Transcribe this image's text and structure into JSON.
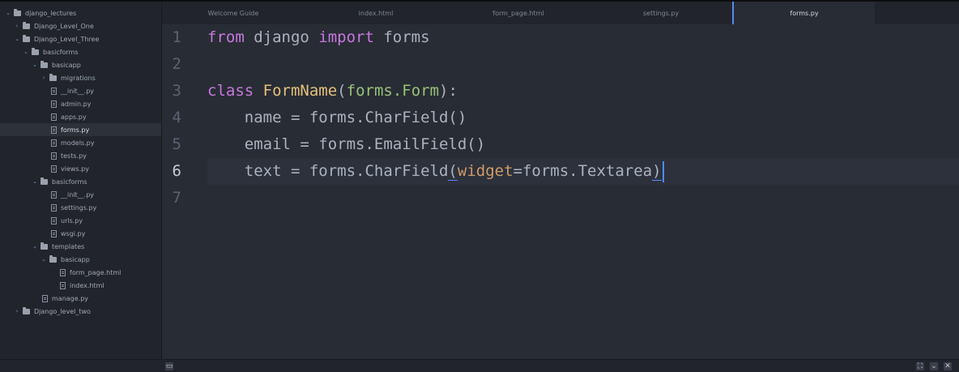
{
  "tree": [
    {
      "label": "django_lectures",
      "kind": "folder",
      "expanded": true,
      "depth": 0
    },
    {
      "label": "Django_Level_One",
      "kind": "folder",
      "expanded": false,
      "depth": 1
    },
    {
      "label": "Django_Level_Three",
      "kind": "folder",
      "expanded": true,
      "depth": 1
    },
    {
      "label": "basicforms",
      "kind": "folder",
      "expanded": true,
      "depth": 2
    },
    {
      "label": "basicapp",
      "kind": "folder",
      "expanded": true,
      "depth": 3
    },
    {
      "label": "migrations",
      "kind": "folder",
      "expanded": false,
      "depth": 4
    },
    {
      "label": "__init__.py",
      "kind": "file",
      "depth": 4
    },
    {
      "label": "admin.py",
      "kind": "file",
      "depth": 4
    },
    {
      "label": "apps.py",
      "kind": "file",
      "depth": 4
    },
    {
      "label": "forms.py",
      "kind": "file",
      "depth": 4,
      "selected": true
    },
    {
      "label": "models.py",
      "kind": "file",
      "depth": 4
    },
    {
      "label": "tests.py",
      "kind": "file",
      "depth": 4
    },
    {
      "label": "views.py",
      "kind": "file",
      "depth": 4
    },
    {
      "label": "basicforms",
      "kind": "folder",
      "expanded": true,
      "depth": 3
    },
    {
      "label": "__init__.py",
      "kind": "file",
      "depth": 4
    },
    {
      "label": "settings.py",
      "kind": "file",
      "depth": 4
    },
    {
      "label": "urls.py",
      "kind": "file",
      "depth": 4
    },
    {
      "label": "wsgi.py",
      "kind": "file",
      "depth": 4
    },
    {
      "label": "templates",
      "kind": "folder",
      "expanded": true,
      "depth": 3
    },
    {
      "label": "basicapp",
      "kind": "folder",
      "expanded": true,
      "depth": 4
    },
    {
      "label": "form_page.html",
      "kind": "file",
      "depth": 5
    },
    {
      "label": "index.html",
      "kind": "file",
      "depth": 5
    },
    {
      "label": "manage.py",
      "kind": "file",
      "depth": 3
    },
    {
      "label": "Django_level_two",
      "kind": "folder",
      "expanded": false,
      "depth": 1
    }
  ],
  "tabs": [
    {
      "label": "Welcome Guide",
      "active": false
    },
    {
      "label": "index.html",
      "active": false
    },
    {
      "label": "form_page.html",
      "active": false
    },
    {
      "label": "settings.py",
      "active": false
    },
    {
      "label": "forms.py",
      "active": true
    }
  ],
  "editor": {
    "current_line": 6,
    "lines": [
      {
        "num": "1",
        "tokens": [
          [
            "kw",
            "from"
          ],
          [
            "t",
            " django "
          ],
          [
            "kw",
            "import"
          ],
          [
            "t",
            " forms"
          ]
        ]
      },
      {
        "num": "2",
        "tokens": []
      },
      {
        "num": "3",
        "tokens": [
          [
            "kw",
            "class"
          ],
          [
            "t",
            " "
          ],
          [
            "cls",
            "FormName"
          ],
          [
            "t",
            "("
          ],
          [
            "inh",
            "forms.Form"
          ],
          [
            "t",
            "):"
          ]
        ]
      },
      {
        "num": "4",
        "tokens": [
          [
            "t",
            "    name = forms.CharField()"
          ]
        ]
      },
      {
        "num": "5",
        "tokens": [
          [
            "t",
            "    email = forms.EmailField()"
          ]
        ]
      },
      {
        "num": "6",
        "tokens": [
          [
            "t",
            "    text = forms.CharField"
          ],
          [
            "brk",
            "("
          ],
          [
            "prm",
            "widget"
          ],
          [
            "t",
            "=forms.Textarea"
          ],
          [
            "brk",
            ")"
          ]
        ]
      },
      {
        "num": "7",
        "tokens": []
      }
    ]
  },
  "statusbar": {
    "icons": [
      "panel-toggle-icon",
      "fullscreen-icon",
      "chevron-down-icon",
      "close-icon"
    ]
  }
}
